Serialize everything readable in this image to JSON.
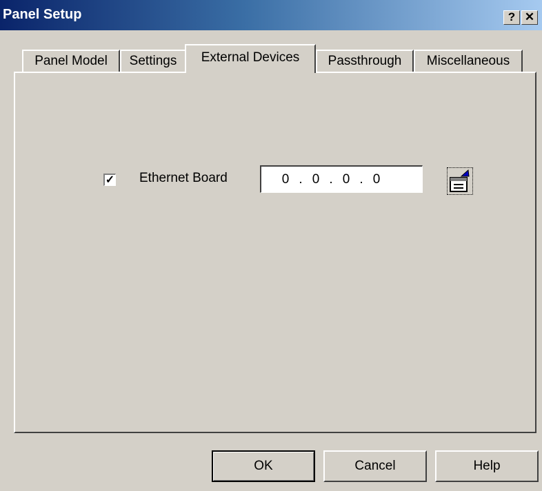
{
  "window": {
    "title": "Panel Setup",
    "help_glyph": "?",
    "close_glyph": "✕"
  },
  "tabs": [
    {
      "label": "Panel Model"
    },
    {
      "label": "Settings"
    },
    {
      "label": "External Devices",
      "active": true
    },
    {
      "label": "Passthrough"
    },
    {
      "label": "Miscellaneous"
    }
  ],
  "ethernet": {
    "checkbox_checked": true,
    "check_glyph": "✓",
    "label": "Ethernet Board",
    "ip": [
      "0",
      "0",
      "0",
      "0"
    ],
    "ip_separator": "."
  },
  "buttons": {
    "ok": "OK",
    "cancel": "Cancel",
    "help": "Help"
  },
  "icons": {
    "properties": "properties-icon"
  },
  "colors": {
    "title_gradient_start": "#0a246a",
    "title_gradient_end": "#a6caf0",
    "face": "#d4d0c8"
  }
}
